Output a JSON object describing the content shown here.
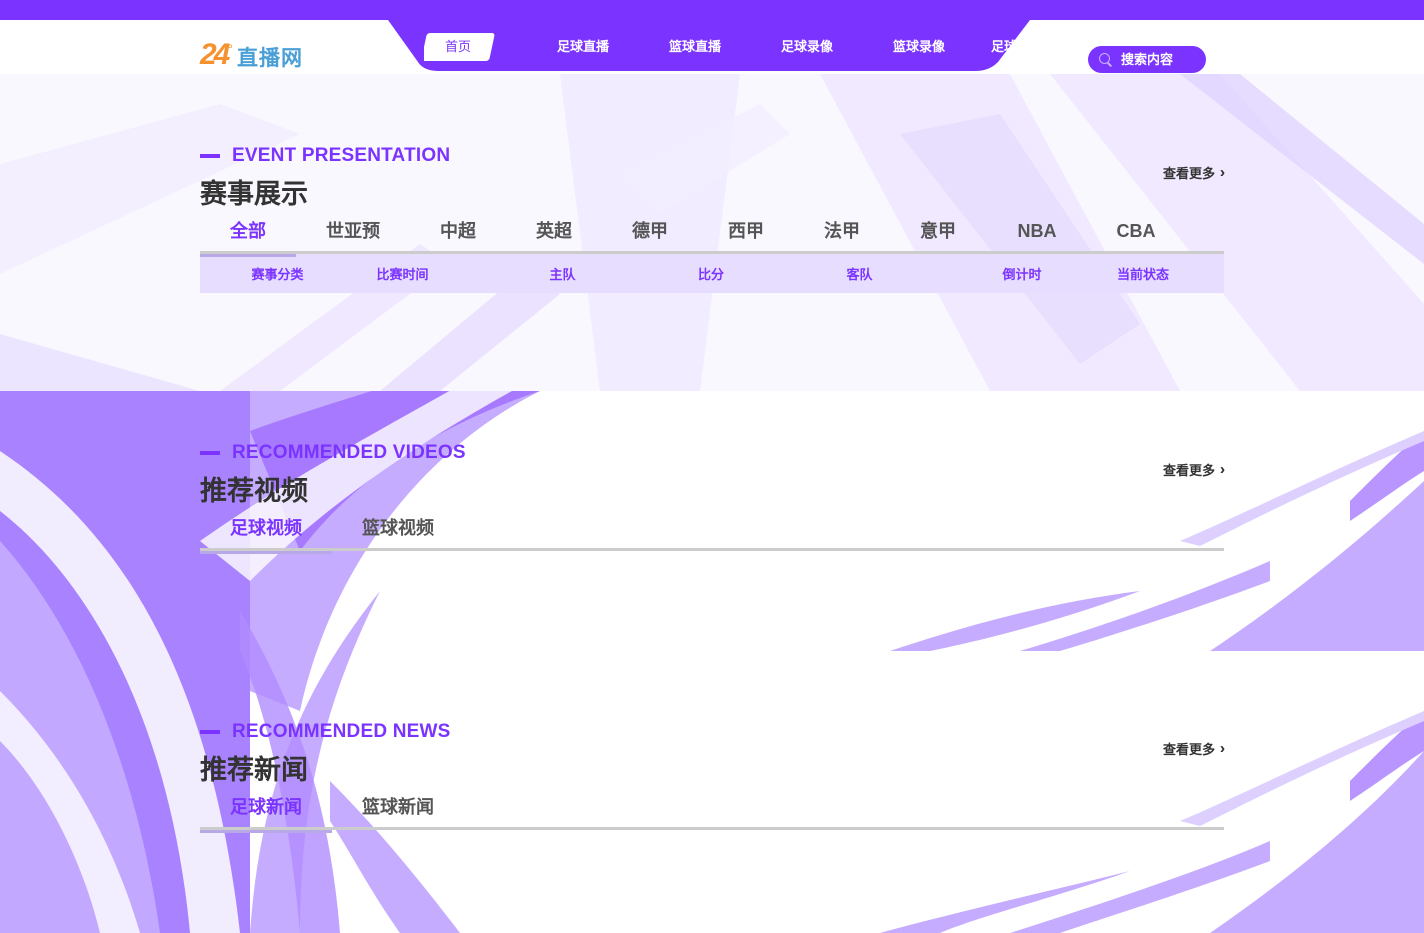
{
  "colors": {
    "brand": "#7b33ff",
    "logo_orange": "#f5922f",
    "logo_blue": "#4a9fd6",
    "table_head_bg": "#e7deff"
  },
  "header": {
    "logo": {
      "number": "24",
      "degree": "°",
      "text": "直播网"
    },
    "nav": [
      {
        "label": "首页",
        "active": true
      },
      {
        "label": "足球直播"
      },
      {
        "label": "篮球直播"
      },
      {
        "label": "足球录像"
      },
      {
        "label": "篮球录像"
      },
      {
        "label": "足球"
      }
    ],
    "search": {
      "placeholder": "搜索内容",
      "icon": "search-icon"
    }
  },
  "events": {
    "eyebrow": "EVENT PRESENTATION",
    "title": "赛事展示",
    "more": "查看更多",
    "more_icon": "double-chevron-right-icon",
    "tabs": [
      "全部",
      "世亚预",
      "中超",
      "英超",
      "德甲",
      "西甲",
      "法甲",
      "意甲",
      "NBA",
      "CBA"
    ],
    "active_tab": 0,
    "columns": [
      "赛事分类",
      "比赛时间",
      "主队",
      "比分",
      "客队",
      "倒计时",
      "当前状态"
    ]
  },
  "videos": {
    "eyebrow": "RECOMMENDED VIDEOS",
    "title": "推荐视频",
    "more": "查看更多",
    "tabs": [
      "足球视频",
      "篮球视频"
    ],
    "active_tab": 0
  },
  "news": {
    "eyebrow": "RECOMMENDED NEWS",
    "title": "推荐新闻",
    "more": "查看更多",
    "tabs": [
      "足球新闻",
      "篮球新闻"
    ],
    "active_tab": 0
  }
}
